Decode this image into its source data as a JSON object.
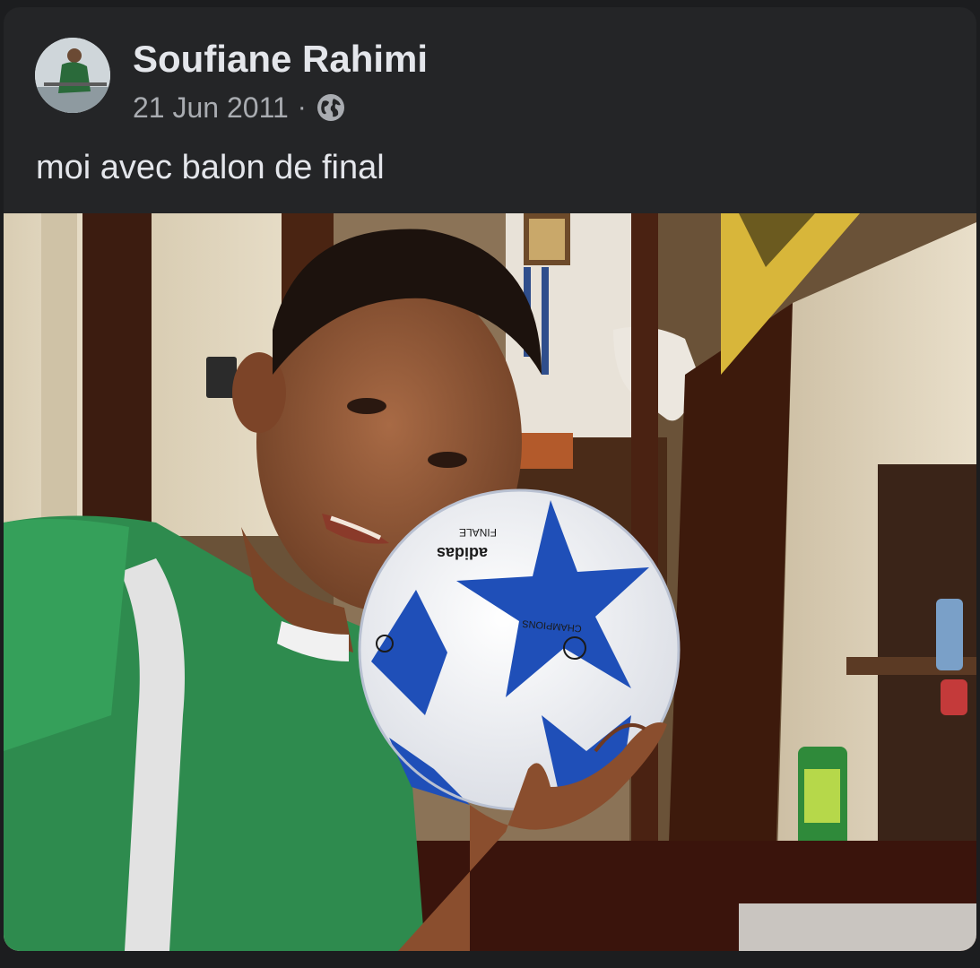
{
  "post": {
    "author": "Soufiane Rahimi",
    "date": "21 Jun 2011",
    "separator": "·",
    "audience_icon": "globe-icon",
    "text": "moi avec balon de final"
  },
  "photo": {
    "ball_brand": "adidas",
    "ball_text_finale": "FINALE",
    "ball_text_league": "CHAMPIONS LEAGUE",
    "colors": {
      "jersey": "#2e8b4e",
      "ball_star": "#1f4fb8",
      "wall": "#e8dcc4",
      "door": "#5a2a1a"
    }
  }
}
